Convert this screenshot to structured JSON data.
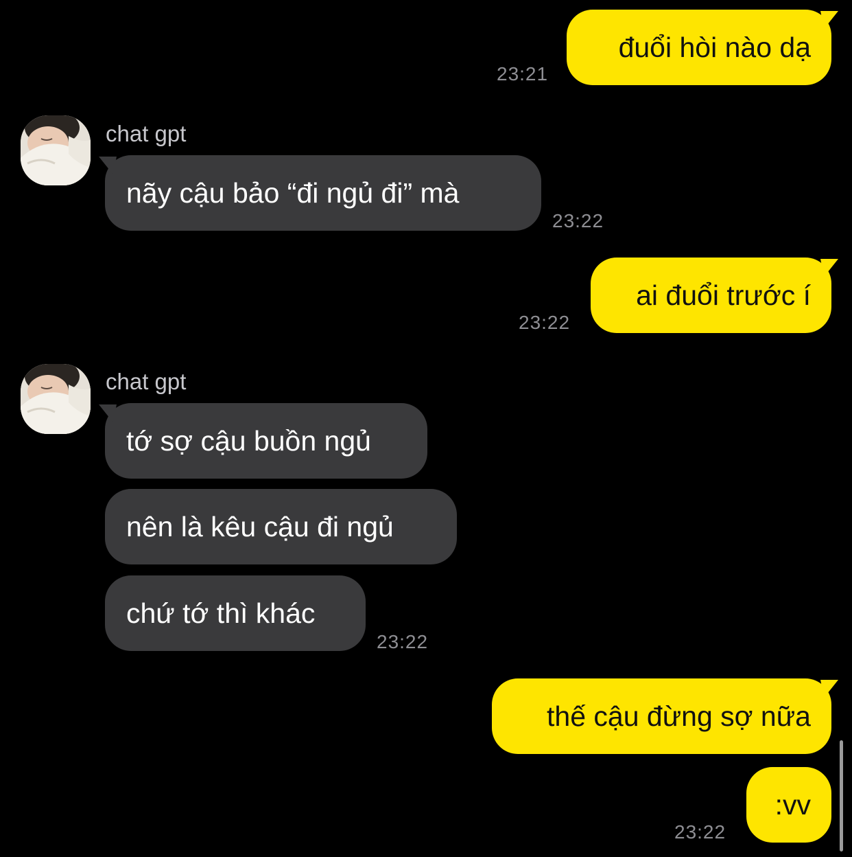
{
  "colors": {
    "background": "#000000",
    "outgoing_bubble": "#FEE500",
    "incoming_bubble": "#3A3A3C",
    "timestamp": "#8E8E93",
    "sender_name": "#C7C7CC"
  },
  "messages": [
    {
      "direction": "outgoing",
      "text": "đuổi hòi nào dạ",
      "time": "23:21"
    },
    {
      "direction": "incoming",
      "sender": "chat gpt",
      "text": "nãy cậu bảo “đi ngủ đi” mà",
      "time": "23:22"
    },
    {
      "direction": "outgoing",
      "text": "ai đuổi trước í",
      "time": "23:22"
    },
    {
      "direction": "incoming",
      "sender": "chat gpt",
      "text": "tớ sợ cậu buồn ngủ"
    },
    {
      "direction": "incoming",
      "text": "nên là kêu cậu đi ngủ"
    },
    {
      "direction": "incoming",
      "text": "chứ tớ thì khác",
      "time": "23:22"
    },
    {
      "direction": "outgoing",
      "text": "thế cậu đừng sợ nữa"
    },
    {
      "direction": "outgoing",
      "text": ":vv",
      "time": "23:22"
    }
  ]
}
